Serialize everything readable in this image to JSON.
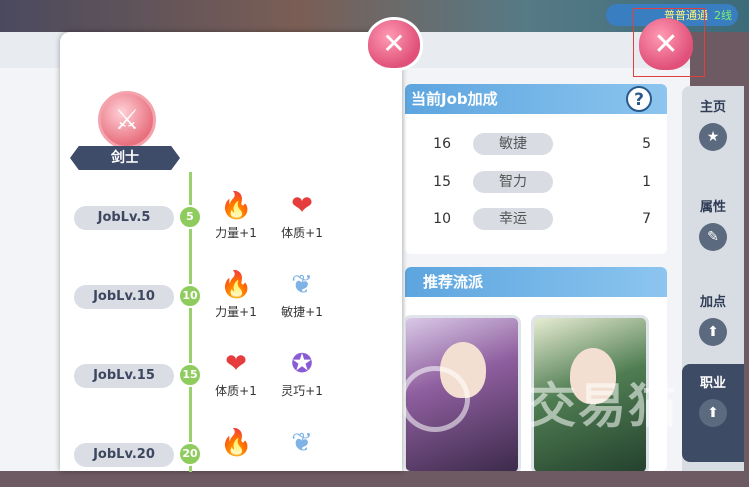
{
  "top_bar": {
    "server_text": "普普通通",
    "line_text": "2线"
  },
  "popup": {
    "close_glyph": "✕",
    "job_icon_glyph": "⚔",
    "job_name": "剑士",
    "levels": [
      {
        "label": "JobLv.5",
        "node": "5",
        "rewards": [
          {
            "icon": "fire-icon",
            "glyph": "🔥",
            "label": "力量+1"
          },
          {
            "icon": "heart-icon",
            "glyph": "❤",
            "label": "体质+1"
          }
        ]
      },
      {
        "label": "JobLv.10",
        "node": "10",
        "rewards": [
          {
            "icon": "fire-icon",
            "glyph": "🔥",
            "label": "力量+1"
          },
          {
            "icon": "wing-icon",
            "glyph": "❦",
            "label": "敏捷+1"
          }
        ]
      },
      {
        "label": "JobLv.15",
        "node": "15",
        "rewards": [
          {
            "icon": "heart-icon",
            "glyph": "❤",
            "label": "体质+1"
          },
          {
            "icon": "star-icon",
            "glyph": "✪",
            "label": "灵巧+1"
          }
        ]
      },
      {
        "label": "JobLv.20",
        "node": "20",
        "rewards": [
          {
            "icon": "fire-icon",
            "glyph": "🔥",
            "label": ""
          },
          {
            "icon": "wing-icon",
            "glyph": "❦",
            "label": ""
          }
        ]
      }
    ]
  },
  "bonus_panel": {
    "title": "当前Job加成",
    "help_glyph": "?",
    "stats": [
      {
        "left_value": "16",
        "name": "敏捷",
        "right_value": "5"
      },
      {
        "left_value": "15",
        "name": "智力",
        "right_value": "1"
      },
      {
        "left_value": "10",
        "name": "幸运",
        "right_value": "7"
      }
    ]
  },
  "rec_panel": {
    "title": "推荐流派"
  },
  "side_nav": {
    "items": [
      {
        "label": "主页",
        "glyph": "★"
      },
      {
        "label": "属性",
        "glyph": "✎"
      },
      {
        "label": "加点",
        "glyph": "⬆"
      },
      {
        "label": "职业",
        "glyph": "⬆"
      }
    ]
  },
  "main_close_glyph": "✕",
  "watermark": "交易猫",
  "colors": {
    "accent_blue": "#5da5df",
    "timeline_green": "#8fcc5e",
    "close_pink": "#e05078",
    "nav_dark": "#3d4b65"
  }
}
